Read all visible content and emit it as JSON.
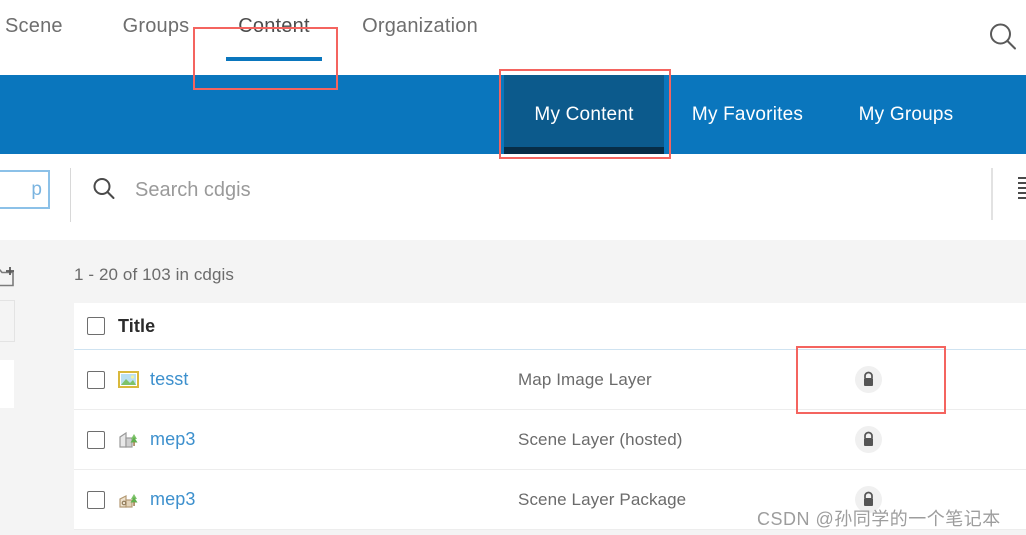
{
  "colors": {
    "nav_blue": "#0a76bd",
    "active_tab_blue": "#0c5a8c",
    "active_tab_underline": "#072d47",
    "tab_underline": "#0a76bd",
    "link_blue": "#3d90cd",
    "annotation_red": "#f4645f",
    "page_background": "#f4f4f4",
    "text_gray": "#6b6b6b"
  },
  "topnav": {
    "items": [
      {
        "label": "Scene",
        "active": false
      },
      {
        "label": "Groups",
        "active": false
      },
      {
        "label": "Content",
        "active": true
      },
      {
        "label": "Organization",
        "active": false
      }
    ],
    "search_icon": "search-icon"
  },
  "bluenav": {
    "items": [
      {
        "label": "My Content",
        "active": true
      },
      {
        "label": "My Favorites",
        "active": false
      },
      {
        "label": "My Groups",
        "active": false
      }
    ]
  },
  "search": {
    "placeholder": "Search cdgis",
    "value": "",
    "icon": "search-icon",
    "left_button_partial_label": "p",
    "right_icon": "list-view-icon"
  },
  "results": {
    "count_text": "1 - 20 of 103 in cdgis"
  },
  "table": {
    "columns": {
      "title": "Title"
    },
    "rows": [
      {
        "title": "tesst",
        "type": "Map Image Layer",
        "icon": "map-image-layer-icon",
        "share": "lock-icon"
      },
      {
        "title": "mep3",
        "type": "Scene Layer (hosted)",
        "icon": "scene-layer-icon",
        "share": "lock-icon"
      },
      {
        "title": "mep3",
        "type": "Scene Layer Package",
        "icon": "scene-layer-package-icon",
        "share": "lock-icon"
      }
    ]
  },
  "annotations": [
    {
      "name": "content-tab-highlight"
    },
    {
      "name": "my-content-tab-highlight"
    },
    {
      "name": "lock-cell-highlight"
    }
  ],
  "watermark": {
    "text": "CSDN @孙同学的一个笔记本"
  },
  "sidebar": {
    "add_folder_icon": "add-folder-icon"
  }
}
